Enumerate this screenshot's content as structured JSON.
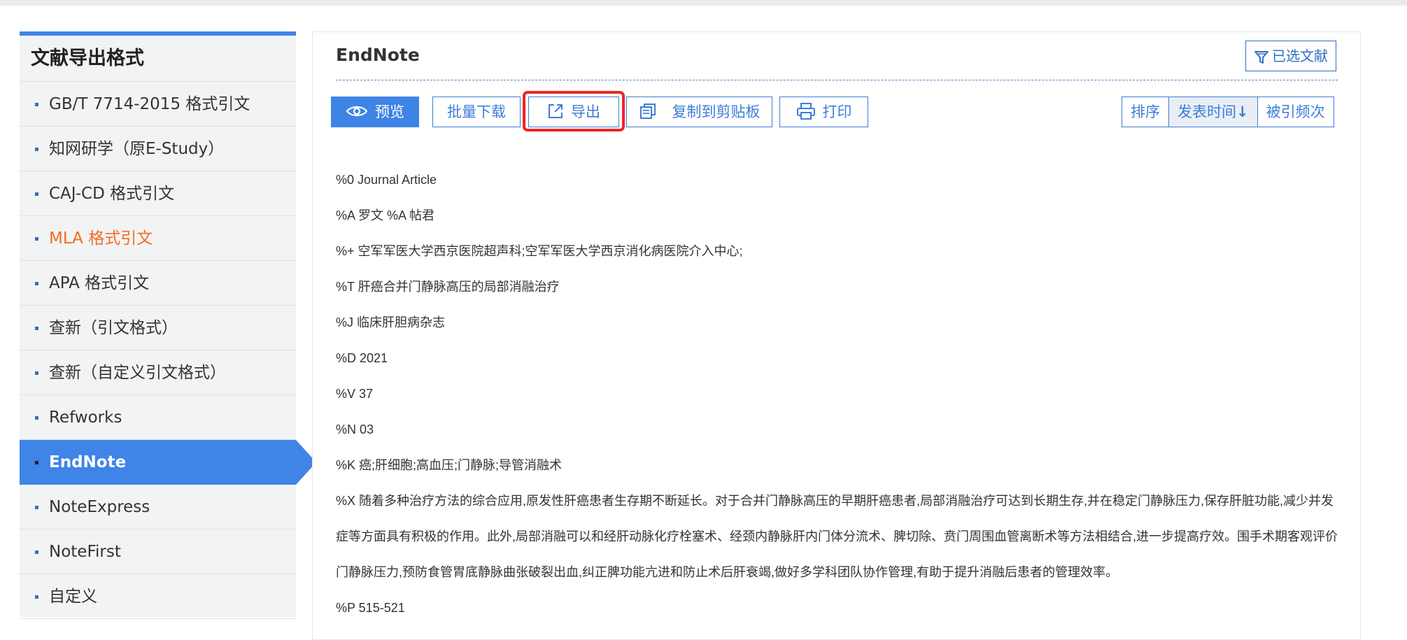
{
  "sidebar": {
    "title": "文献导出格式",
    "items": [
      {
        "label": "GB/T 7714-2015 格式引文",
        "state": "normal"
      },
      {
        "label": "知网研学（原E-Study）",
        "state": "normal"
      },
      {
        "label": "CAJ-CD 格式引文",
        "state": "normal"
      },
      {
        "label": "MLA 格式引文",
        "state": "highlight"
      },
      {
        "label": "APA 格式引文",
        "state": "normal"
      },
      {
        "label": "查新（引文格式）",
        "state": "normal"
      },
      {
        "label": "查新（自定义引文格式）",
        "state": "normal"
      },
      {
        "label": "Refworks",
        "state": "normal"
      },
      {
        "label": "EndNote",
        "state": "active"
      },
      {
        "label": "NoteExpress",
        "state": "normal"
      },
      {
        "label": "NoteFirst",
        "state": "normal"
      },
      {
        "label": "自定义",
        "state": "normal"
      }
    ]
  },
  "main": {
    "title": "EndNote",
    "selected_label": "已选文献",
    "toolbar": {
      "preview": "预览",
      "batch_download": "批量下载",
      "export": "导出",
      "copy": "复制到剪贴板",
      "print": "打印"
    },
    "sort": {
      "label": "排序",
      "pub_time": "发表时间",
      "cited": "被引频次"
    },
    "lines": [
      "%0 Journal Article",
      "%A 罗文 %A 帖君",
      "%+ 空军军医大学西京医院超声科;空军军医大学西京消化病医院介入中心;",
      "%T 肝癌合并门静脉高压的局部消融治疗",
      "%J 临床肝胆病杂志",
      "%D 2021",
      "%V 37",
      "%N 03",
      "%K 癌;肝细胞;高血压;门静脉;导管消融术"
    ],
    "abstract": "%X 随着多种治疗方法的综合应用,原发性肝癌患者生存期不断延长。对于合并门静脉高压的早期肝癌患者,局部消融治疗可达到长期生存,并在稳定门静脉压力,保存肝脏功能,减少并发症等方面具有积极的作用。此外,局部消融可以和经肝动脉化疗栓塞术、经颈内静脉肝内门体分流术、脾切除、贲门周围血管离断术等方法相结合,进一步提高疗效。围手术期客观评价门静脉压力,预防食管胃底静脉曲张破裂出血,纠正脾功能亢进和防止术后肝衰竭,做好多学科团队协作管理,有助于提升消融后患者的管理效率。",
    "pages_line": "%P 515-521"
  },
  "colors": {
    "accent": "#3e84e6",
    "highlight_text": "#f26d21",
    "callout_red": "#f22323"
  }
}
